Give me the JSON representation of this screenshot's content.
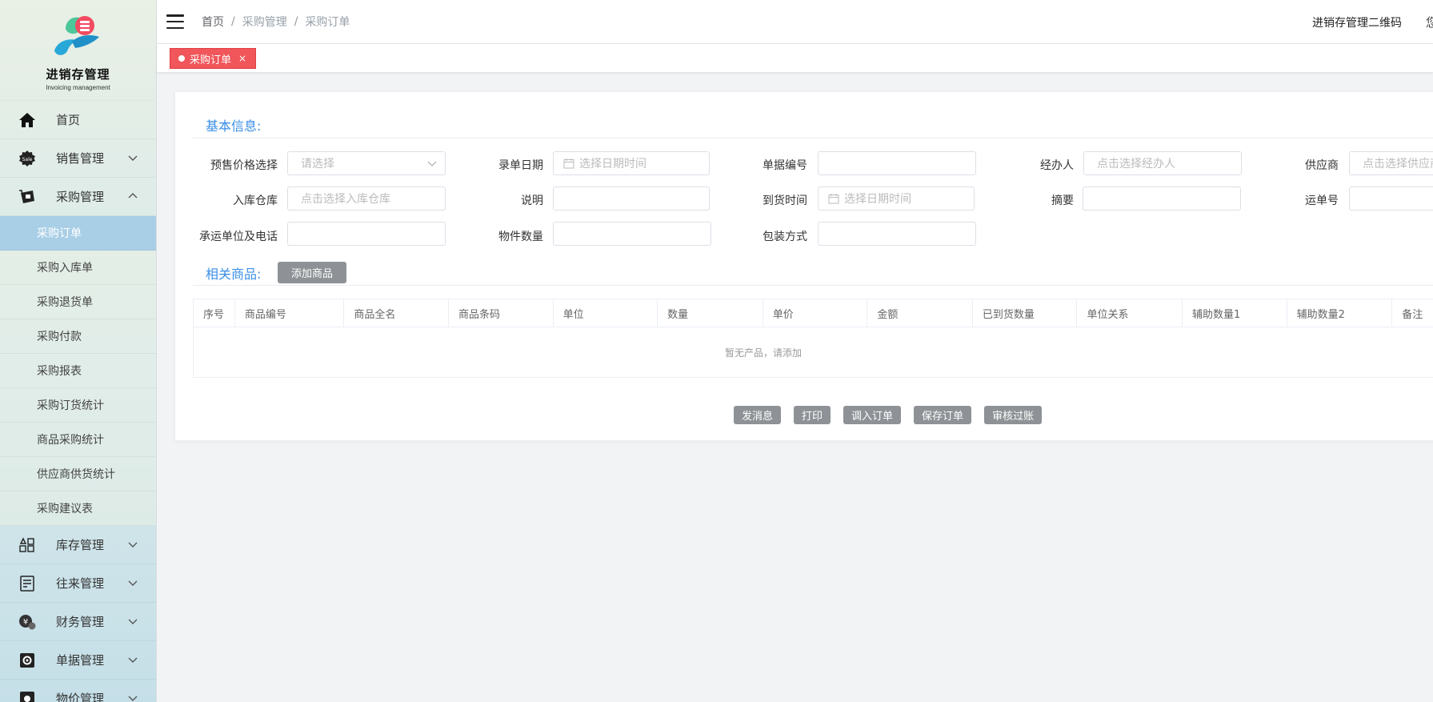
{
  "logo": {
    "title": "进销存管理",
    "subtitle": "Invoicing management",
    "colors": {
      "leaf": "#28a8d8",
      "flower": "#f24b60"
    }
  },
  "sidebar": {
    "home": {
      "label": "首页",
      "icon": "home-icon"
    },
    "sales": {
      "label": "销售管理",
      "icon": "sale-badge-icon"
    },
    "purchase": {
      "label": "采购管理",
      "icon": "purchase-icon"
    },
    "purchase_children": [
      {
        "label": "采购订单",
        "active": true
      },
      {
        "label": "采购入库单"
      },
      {
        "label": "采购退货单"
      },
      {
        "label": "采购付款"
      },
      {
        "label": "采购报表"
      },
      {
        "label": "采购订货统计"
      },
      {
        "label": "商品采购统计"
      },
      {
        "label": "供应商供货统计"
      },
      {
        "label": "采购建议表"
      }
    ],
    "inventory": {
      "label": "库存管理",
      "icon": "inventory-icon"
    },
    "contacts": {
      "label": "往来管理",
      "icon": "contacts-icon"
    },
    "finance": {
      "label": "财务管理",
      "icon": "finance-icon"
    },
    "documents": {
      "label": "单据管理",
      "icon": "document-gear-icon"
    },
    "price": {
      "label": "物价管理",
      "icon": "price-icon"
    }
  },
  "header": {
    "breadcrumb": [
      "首页",
      "采购管理",
      "采购订单"
    ],
    "breadcrumb_sep": "/",
    "qr_label": "进销存管理二维码",
    "user_cut": "您"
  },
  "tabs": [
    {
      "label": "采购订单",
      "close": "×"
    }
  ],
  "form": {
    "basic_title": "基本信息:",
    "price_label": "预售价格选择",
    "price_placeholder": "请选择",
    "date_label": "录单日期",
    "date_placeholder": "选择日期时间",
    "doc_no_label": "单据编号",
    "handler_label": "经办人",
    "handler_placeholder": "点击选择经办人",
    "supplier_label": "供应商",
    "supplier_placeholder": "点击选择供应商",
    "warehouse_label": "入库仓库",
    "warehouse_placeholder": "点击选择入库仓库",
    "desc_label": "说明",
    "arrive_label": "到货时间",
    "arrive_placeholder": "选择日期时间",
    "summary_label": "摘要",
    "waybill_label": "运单号",
    "carrier_label": "承运单位及电话",
    "pieces_label": "物件数量",
    "package_label": "包装方式",
    "goods_title": "相关商品:",
    "add_goods": "添加商品"
  },
  "table": {
    "columns": [
      "序号",
      "商品编号",
      "商品全名",
      "商品条码",
      "单位",
      "数量",
      "单价",
      "金额",
      "已到货数量",
      "单位关系",
      "辅助数量1",
      "辅助数量2",
      "备注"
    ],
    "empty": "暂无产品，请添加"
  },
  "actions": [
    "发消息",
    "打印",
    "调入订单",
    "保存订单",
    "审核过账"
  ],
  "colors": {
    "accent": "#3a8ee6",
    "tab": "#f0565a",
    "button": "#8e9296",
    "active_menu": "#a9cfe6"
  }
}
